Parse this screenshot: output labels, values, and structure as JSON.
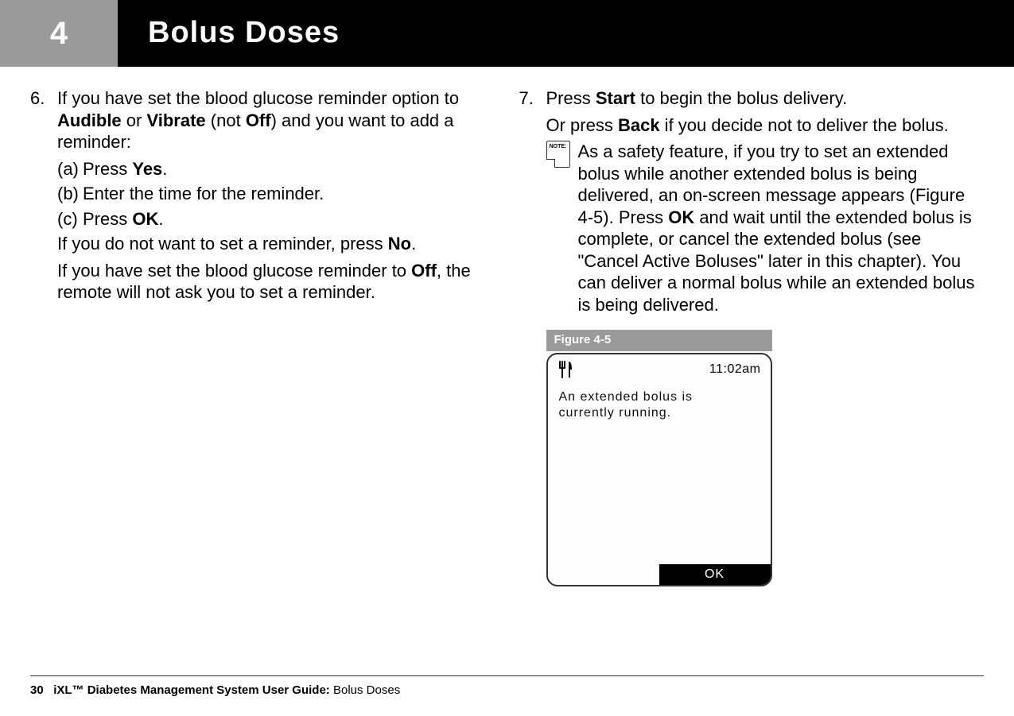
{
  "header": {
    "chapter_number": "4",
    "title": "Bolus Doses"
  },
  "left": {
    "step_num": "6.",
    "line1_pre": "If you have set the blood glucose reminder option to ",
    "line1_b1": "Audible",
    "line2_pre": "or ",
    "line2_b1": "Vibrate",
    "line2_mid": " (not ",
    "line2_b2": "Off",
    "line2_post": ") and you want to add a reminder:",
    "a_lbl": "(a)",
    "a_pre": "Press ",
    "a_b": "Yes",
    "a_post": ".",
    "b_lbl": "(b)",
    "b_txt": "Enter the time for the reminder.",
    "c_lbl": "(c)",
    "c_pre": "Press ",
    "c_b": "OK",
    "c_post": ".",
    "no_pre": "If you do not want to set a reminder, press ",
    "no_b": "No",
    "no_post": ".",
    "off_pre": "If you have set the blood glucose reminder to ",
    "off_b": "Off",
    "off_post": ", the remote will not ask you to set a reminder."
  },
  "right": {
    "step_num": "7.",
    "line1_pre": "Press ",
    "line1_b": "Start",
    "line1_post": " to begin the bolus delivery.",
    "line2_pre": "Or press ",
    "line2_b": "Back",
    "line2_post": " if you decide not to deliver the bolus.",
    "note_label": "NOTE:",
    "note_pre": "As a safety feature, if you try to set an extended bolus while another extended bolus is being delivered, an on-screen message appears (Figure 4-5). Press ",
    "note_b": "OK",
    "note_post": " and wait until the extended bolus is complete, or cancel the extended bolus (see \"Cancel Active Boluses\" later in this chapter). You can deliver a normal bolus while an extended bolus is being delivered."
  },
  "figure": {
    "label": "Figure 4-5",
    "device_time": "11:02am",
    "device_msg1": "An extended bolus is",
    "device_msg2": "currently running.",
    "device_ok": "OK"
  },
  "footer": {
    "page": "30",
    "guide_b": "iXL™ Diabetes Management System User Guide: ",
    "guide_plain": "Bolus Doses"
  }
}
